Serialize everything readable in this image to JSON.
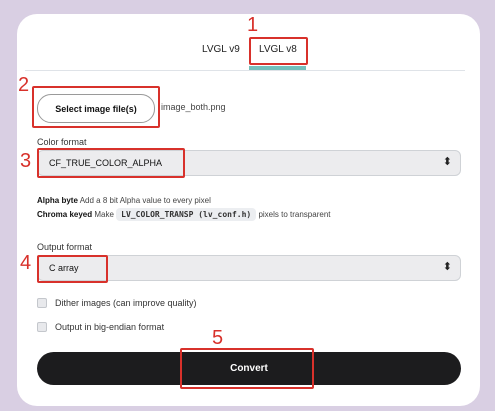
{
  "tabs": [
    {
      "label": "LVGL v9"
    },
    {
      "label": "LVGL v8"
    }
  ],
  "image_select": {
    "button_label": "Select image file(s)",
    "filename": "image_both.png"
  },
  "color_format": {
    "label": "Color format",
    "value": "CF_TRUE_COLOR_ALPHA"
  },
  "info": {
    "alpha_title": "Alpha byte",
    "alpha_text": "Add a 8 bit Alpha value to every pixel",
    "chroma_title": "Chroma keyed",
    "chroma_text_before": "Make",
    "chroma_code": "LV_COLOR_TRANSP (lv_conf.h)",
    "chroma_text_after": "pixels to transparent"
  },
  "output_format": {
    "label": "Output format",
    "value": "C array"
  },
  "options": [
    {
      "label": "Dither images (can improve quality)",
      "checked": false
    },
    {
      "label": "Output in big-endian format",
      "checked": false
    }
  ],
  "convert_label": "Convert",
  "annotations": {
    "n1": "1",
    "n2": "2",
    "n3": "3",
    "n4": "4",
    "n5": "5",
    "color": "#d8312b"
  },
  "colors": {
    "background": "#d9cfe3",
    "accent": "#74c0bc",
    "button_dark": "#1c1c1e"
  }
}
